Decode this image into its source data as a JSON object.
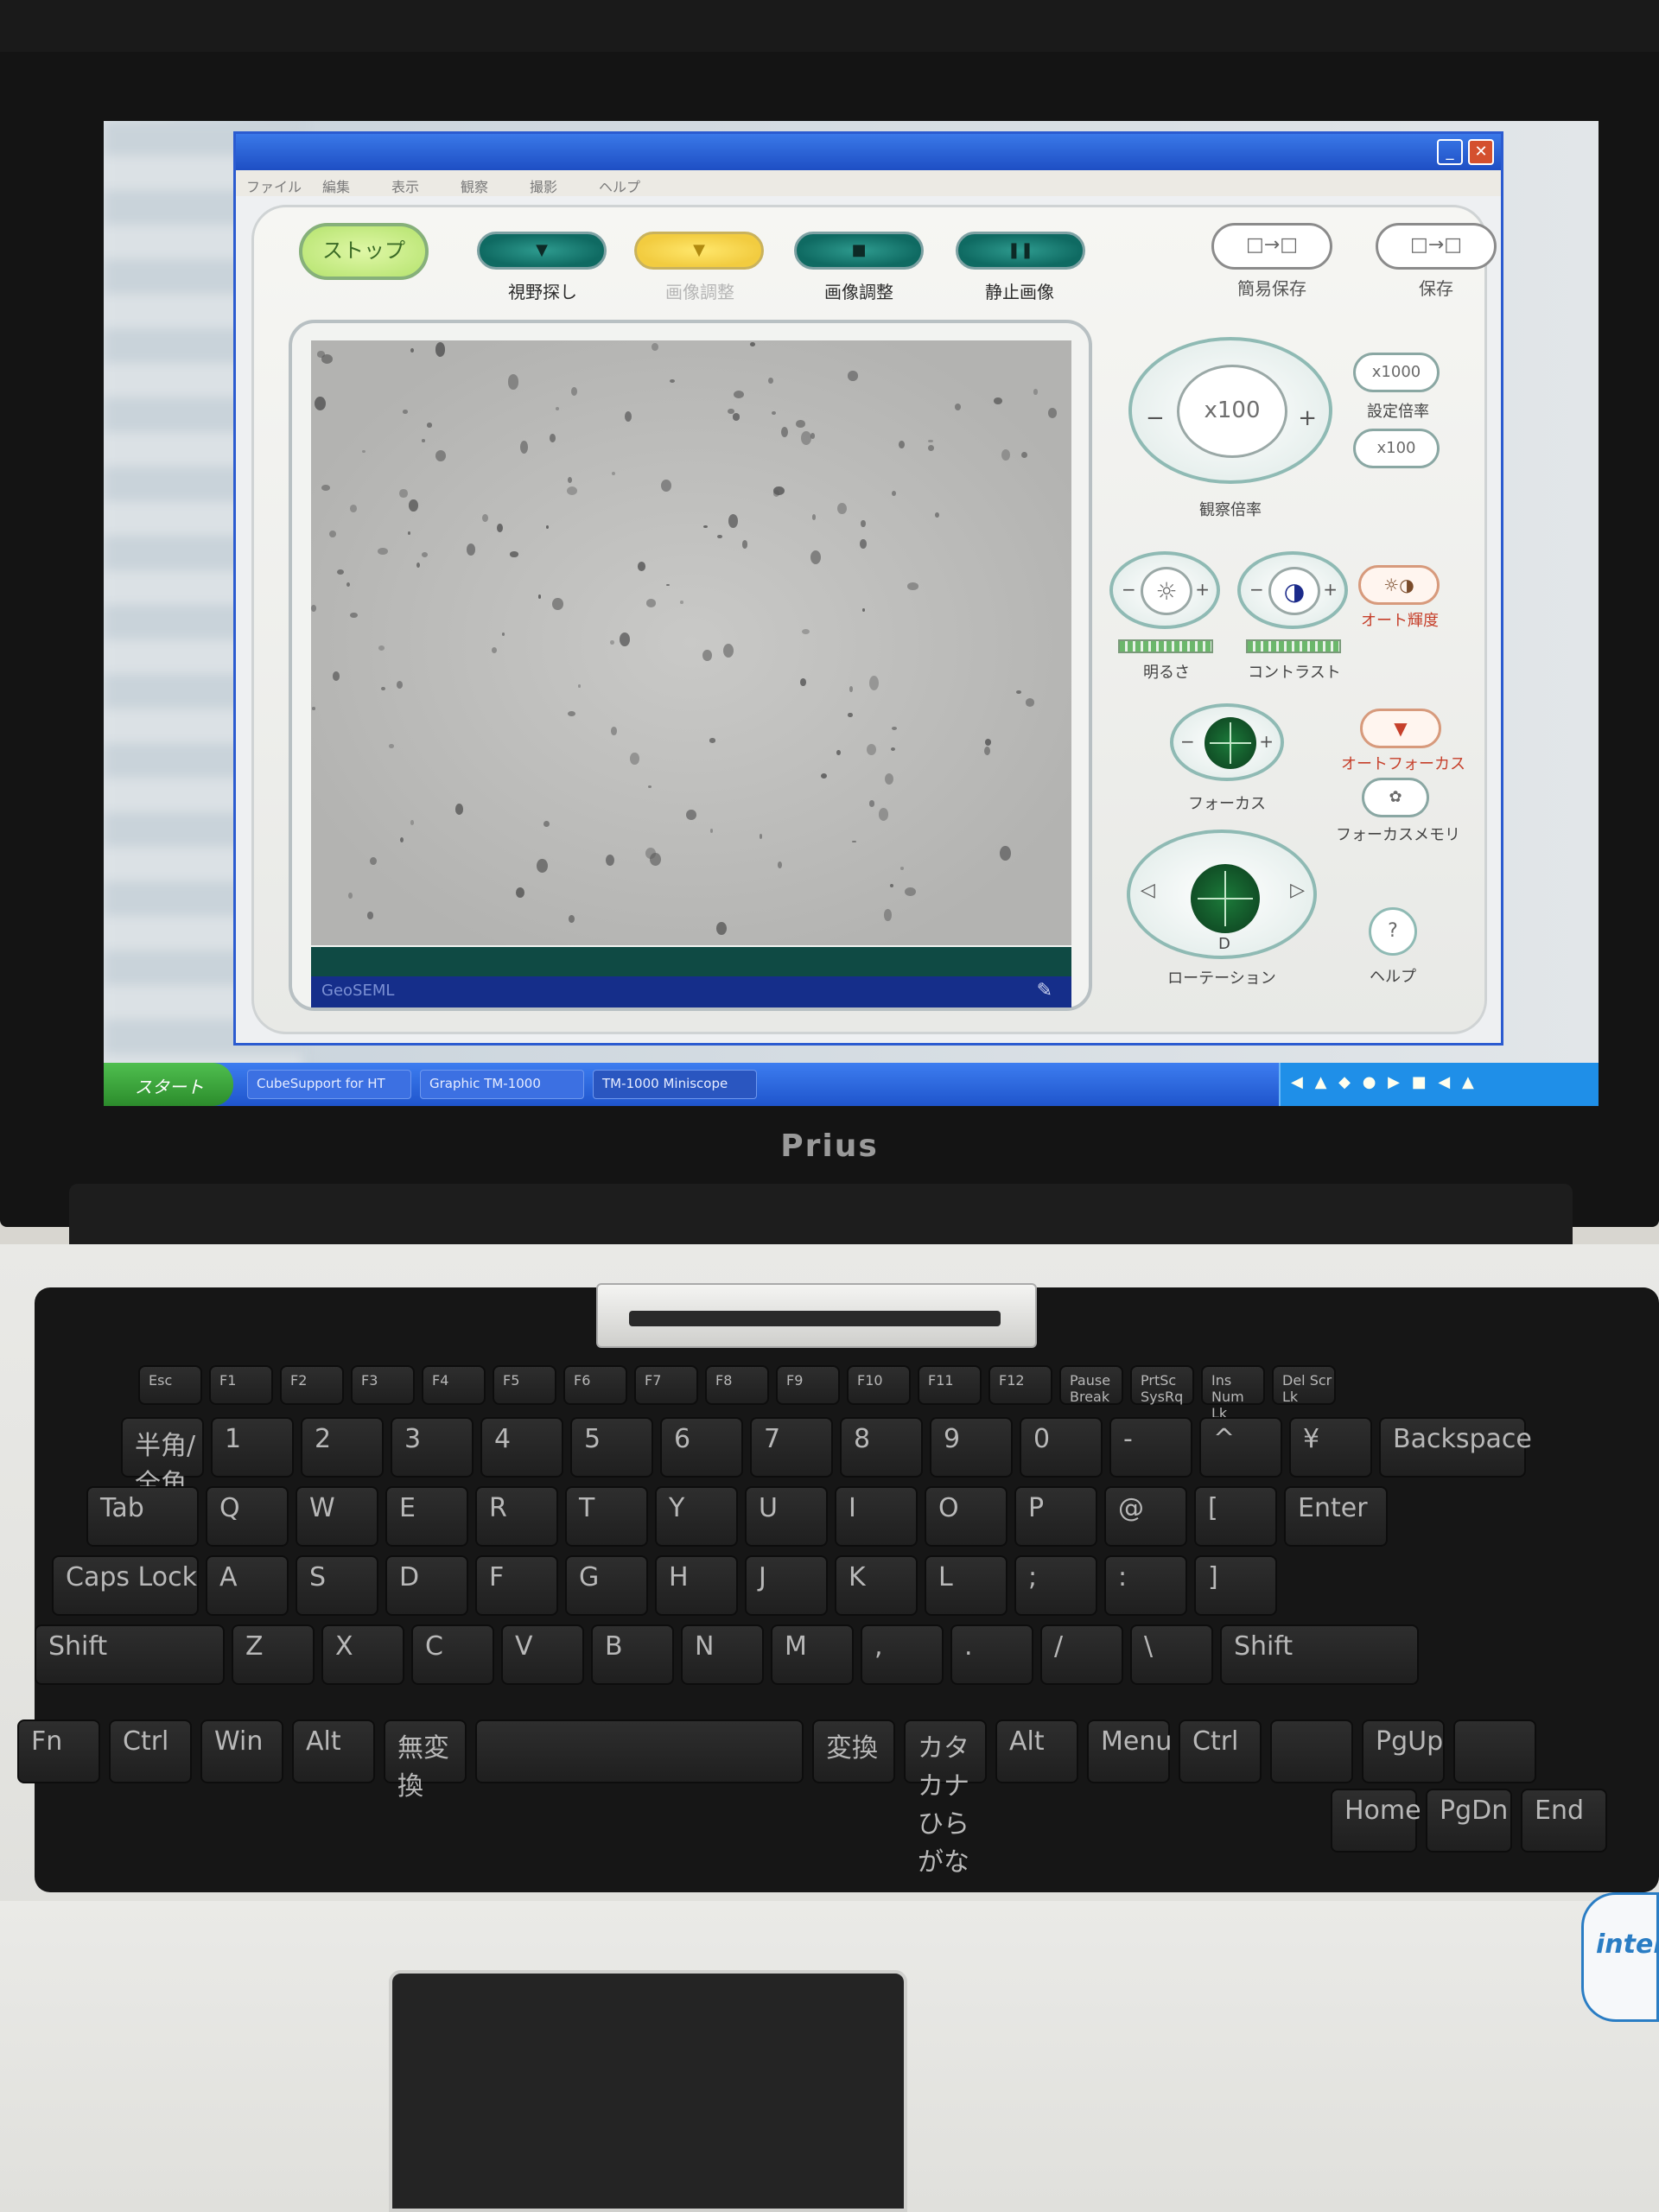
{
  "window": {
    "menu_items": [
      "ファイル",
      "編集",
      "表示",
      "観察",
      "撮影",
      "ヘルプ"
    ]
  },
  "toolbar": {
    "stop_label": "ストップ",
    "buttons": [
      {
        "label": "視野探し",
        "color": "#0f6a62"
      },
      {
        "label": "画像調整",
        "color": "#f2cc40"
      },
      {
        "label": "画像調整",
        "color": "#0f6a62"
      },
      {
        "label": "静止画像",
        "color": "#0f6a62"
      }
    ],
    "quick_save": {
      "icon": "□→□",
      "label": "簡易保存"
    },
    "save": {
      "icon": "□→□",
      "label": "保存"
    }
  },
  "viewer": {
    "status_text": "GeoSEML"
  },
  "magnification": {
    "current": "x100",
    "label": "観察倍率",
    "preset_high": "x1000",
    "preset_low": "x100",
    "preset_label": "設定倍率"
  },
  "brightness": {
    "label": "明るさ",
    "level": 0.55
  },
  "contrast": {
    "label": "コントラスト",
    "level": 0.85
  },
  "auto_adjust": {
    "label": "オート輝度"
  },
  "focus": {
    "label": "フォーカス"
  },
  "auto_focus": {
    "label": "オートフォーカス"
  },
  "focus_memory": {
    "label": "フォーカスメモリ"
  },
  "rotation": {
    "label": "ローテーション",
    "bottom": "D"
  },
  "help": {
    "label": "ヘルプ"
  },
  "taskbar": {
    "start": "スタート",
    "tasks": [
      "CubeSupport for HT",
      "Graphic TM-1000",
      "TM-1000 Miniscope"
    ],
    "tray_glyphs": "◀ ▲ ◆ ● ▶ ■ ◀ ▲"
  },
  "laptop": {
    "brand": "Prius",
    "intel": "intel"
  },
  "keyboard": {
    "row_fn": [
      "Esc",
      "F1",
      "F2",
      "F3",
      "F4",
      "F5",
      "F6",
      "F7",
      "F8",
      "F9",
      "F10",
      "F11",
      "F12",
      "Pause Break",
      "PrtSc SysRq",
      "Ins Num Lk",
      "Del Scr Lk"
    ],
    "row_num": [
      "半角/全角",
      "1",
      "2",
      "3",
      "4",
      "5",
      "6",
      "7",
      "8",
      "9",
      "0",
      "-",
      "^",
      "¥",
      "Backspace"
    ],
    "row_q": [
      "Tab",
      "Q",
      "W",
      "E",
      "R",
      "T",
      "Y",
      "U",
      "I",
      "O",
      "P",
      "@",
      "[",
      "Enter"
    ],
    "row_a": [
      "Caps Lock",
      "A",
      "S",
      "D",
      "F",
      "G",
      "H",
      "J",
      "K",
      "L",
      ";",
      ":",
      "]"
    ],
    "row_z": [
      "Shift",
      "Z",
      "X",
      "C",
      "V",
      "B",
      "N",
      "M",
      ",",
      ".",
      "/",
      "\\",
      "Shift"
    ],
    "row_space": [
      "Fn",
      "Ctrl",
      "Win",
      "Alt",
      "無変換",
      "",
      "変換",
      "カタカナ ひらがな",
      "Alt",
      "Menu",
      "Ctrl",
      "",
      "PgUp",
      ""
    ],
    "row_nav": [
      "Home",
      "PgDn",
      "End"
    ]
  }
}
